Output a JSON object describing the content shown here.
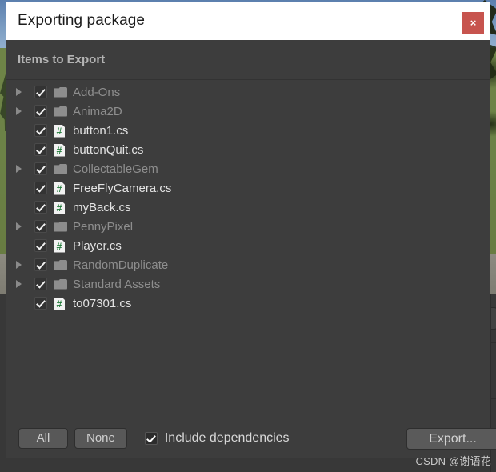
{
  "window": {
    "title": "Exporting package",
    "close_label": "×"
  },
  "section": {
    "header": "Items to Export"
  },
  "items": [
    {
      "label": "Add-Ons",
      "kind": "folder",
      "checked": true,
      "expandable": true,
      "icon": "folder-icon"
    },
    {
      "label": "Anima2D",
      "kind": "folder",
      "checked": true,
      "expandable": true,
      "icon": "folder-icon"
    },
    {
      "label": "button1.cs",
      "kind": "file",
      "checked": true,
      "expandable": false,
      "icon": "csharp-script-icon"
    },
    {
      "label": "buttonQuit.cs",
      "kind": "file",
      "checked": true,
      "expandable": false,
      "icon": "csharp-script-icon"
    },
    {
      "label": "CollectableGem",
      "kind": "folder",
      "checked": true,
      "expandable": true,
      "icon": "folder-icon"
    },
    {
      "label": "FreeFlyCamera.cs",
      "kind": "file",
      "checked": true,
      "expandable": false,
      "icon": "csharp-script-icon"
    },
    {
      "label": "myBack.cs",
      "kind": "file",
      "checked": true,
      "expandable": false,
      "icon": "csharp-script-icon"
    },
    {
      "label": "PennyPixel",
      "kind": "folder",
      "checked": true,
      "expandable": true,
      "icon": "folder-icon"
    },
    {
      "label": "Player.cs",
      "kind": "file",
      "checked": true,
      "expandable": false,
      "icon": "csharp-script-icon"
    },
    {
      "label": "RandomDuplicate",
      "kind": "folder",
      "checked": true,
      "expandable": true,
      "icon": "folder-icon"
    },
    {
      "label": "Standard Assets",
      "kind": "folder",
      "checked": true,
      "expandable": true,
      "icon": "folder-icon"
    },
    {
      "label": "to07301.cs",
      "kind": "file",
      "checked": true,
      "expandable": false,
      "icon": "csharp-script-icon"
    }
  ],
  "footer": {
    "all_label": "All",
    "none_label": "None",
    "include_dependencies_label": "Include dependencies",
    "include_dependencies_checked": true,
    "export_label": "Export..."
  },
  "watermark": {
    "text": "CSDN @谢语花"
  },
  "colors": {
    "dialog_bg": "#3d3d3d",
    "titlebar_bg": "#ffffff",
    "close_red": "#c7544e",
    "file_text": "#e3e3e3",
    "folder_text": "#8e8e8e",
    "csharp_green": "#1f7a38"
  }
}
